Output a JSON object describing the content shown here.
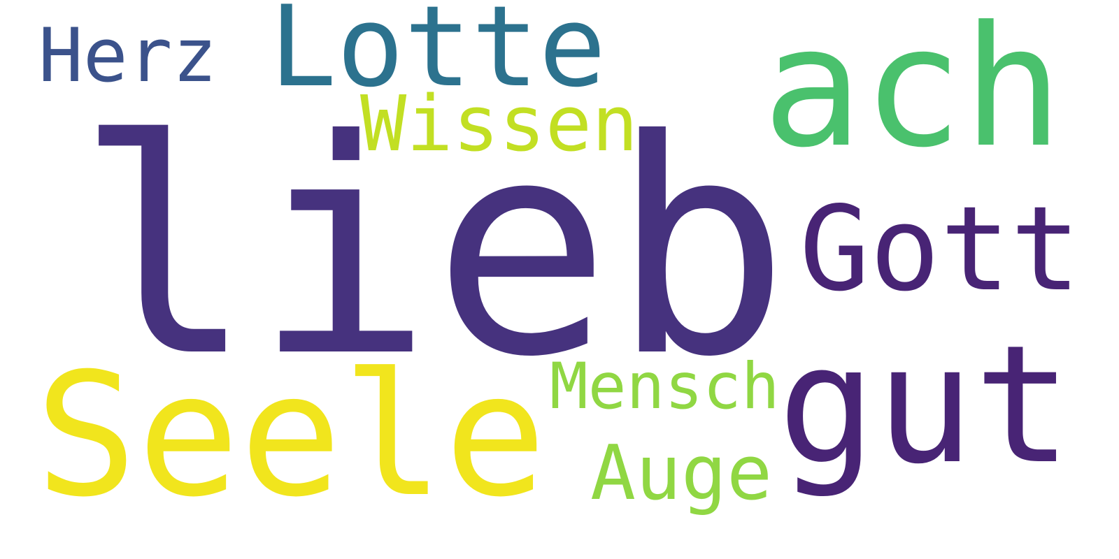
{
  "words": [
    {
      "text": "lieb",
      "color": "#46327e"
    },
    {
      "text": "Lotte",
      "color": "#2c728e"
    },
    {
      "text": "Herz",
      "color": "#3b528b"
    },
    {
      "text": "Wissen",
      "color": "#c2df23"
    },
    {
      "text": "ach",
      "color": "#4ac16d"
    },
    {
      "text": "Gott",
      "color": "#482475"
    },
    {
      "text": "gut",
      "color": "#482475"
    },
    {
      "text": "Seele",
      "color": "#f1e51d"
    },
    {
      "text": "Mensch",
      "color": "#90d743"
    },
    {
      "text": "Auge",
      "color": "#90d743"
    }
  ]
}
